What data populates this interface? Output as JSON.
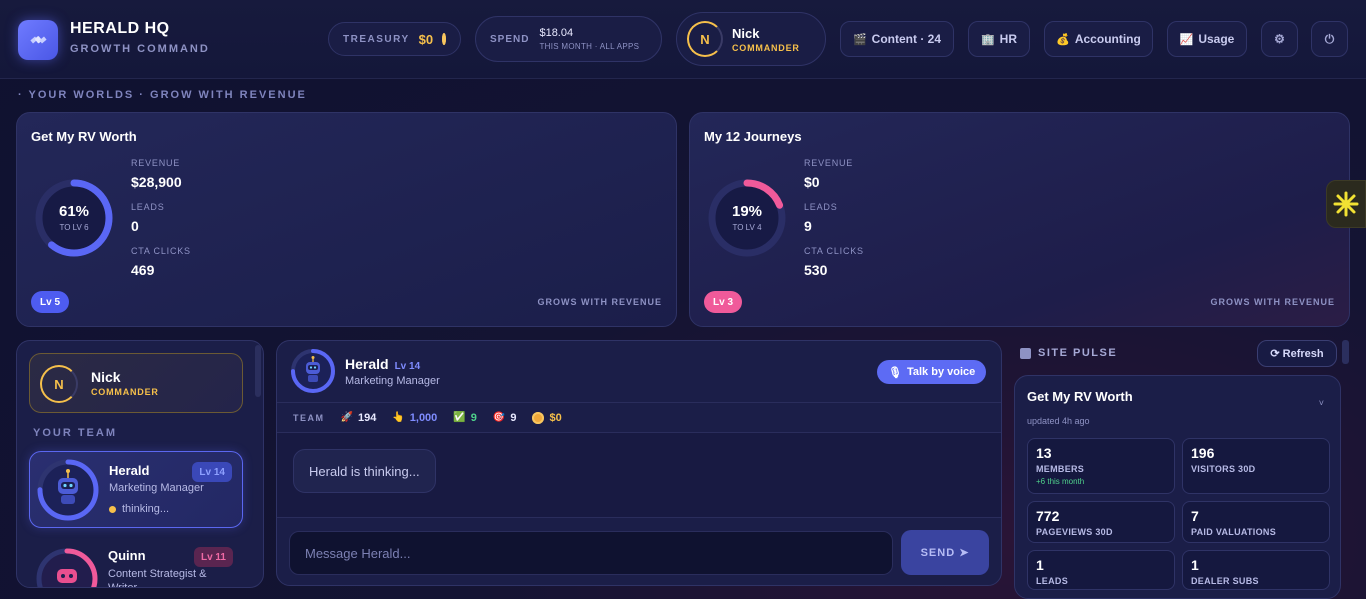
{
  "header": {
    "title": "HERALD HQ",
    "subtitle": "GROWTH COMMAND",
    "treasury_label": "TREASURY",
    "treasury_value": "$0",
    "spend_label": "SPEND",
    "spend_value": "$18.04",
    "spend_period": "THIS MONTH · ALL APPS",
    "user_initial": "N",
    "user_name": "Nick",
    "user_rank": "COMMANDER",
    "nav": {
      "content": "Content · 24",
      "hr": "HR",
      "accounting": "Accounting",
      "usage": "Usage"
    }
  },
  "worlds": {
    "section_label": "· YOUR WORLDS · GROW WITH REVENUE",
    "cards": [
      {
        "title": "Get My RV Worth",
        "progress_pct": "61%",
        "progress_value": 0.61,
        "progress_sub": "TO LV 6",
        "revenue_label": "REVENUE",
        "revenue": "$28,900",
        "leads_label": "LEADS",
        "leads": "0",
        "cta_label": "CTA CLICKS",
        "cta": "469",
        "level": "Lv 5",
        "footer": "GROWS WITH REVENUE",
        "accent": "#5a67f5"
      },
      {
        "title": "My 12 Journeys",
        "progress_pct": "19%",
        "progress_value": 0.19,
        "progress_sub": "TO LV 4",
        "revenue_label": "REVENUE",
        "revenue": "$0",
        "leads_label": "LEADS",
        "leads": "9",
        "cta_label": "CTA CLICKS",
        "cta": "530",
        "level": "Lv 3",
        "footer": "GROWS WITH REVENUE",
        "accent": "#f05a9a"
      }
    ]
  },
  "sidebar": {
    "commander_initial": "N",
    "commander_name": "Nick",
    "commander_rank": "COMMANDER",
    "team_label": "YOUR TEAM",
    "members": [
      {
        "name": "Herald",
        "role": "Marketing Manager",
        "level": "Lv 14",
        "status": "thinking...",
        "progress_value": 0.75
      },
      {
        "name": "Quinn",
        "role": "Content Strategist & Writer",
        "level": "Lv 11",
        "progress_value": 0.3
      }
    ]
  },
  "chat": {
    "agent_name": "Herald",
    "agent_level": "Lv 14",
    "agent_role": "Marketing Manager",
    "voice_label": "Talk by voice",
    "team_label": "TEAM",
    "team_stats": [
      {
        "icon": "rocket-icon",
        "glyph": "🚀",
        "value": "194",
        "color": "#e8e9ff"
      },
      {
        "icon": "pointer-icon",
        "glyph": "👆",
        "value": "1,000",
        "color": "#7f8cff"
      },
      {
        "icon": "check-icon",
        "glyph": "✅",
        "value": "9",
        "color": "#4fd18b"
      },
      {
        "icon": "target-icon",
        "glyph": "🎯",
        "value": "9",
        "color": "#e8e9ff"
      },
      {
        "icon": "coin-icon",
        "glyph": "",
        "value": "$0",
        "color": "#f6c04b"
      }
    ],
    "thinking_message": "Herald is thinking...",
    "input_placeholder": "Message Herald...",
    "send_label": "SEND ➤"
  },
  "pulse": {
    "label": "SITE PULSE",
    "refresh_label": "⟳ Refresh",
    "site_title": "Get My RV Worth",
    "updated": "updated 4h ago",
    "metrics": [
      {
        "value": "13",
        "label": "MEMBERS",
        "delta": "+6 this month"
      },
      {
        "value": "196",
        "label": "VISITORS 30D"
      },
      {
        "value": "772",
        "label": "PAGEVIEWS 30D"
      },
      {
        "value": "7",
        "label": "PAID VALUATIONS"
      },
      {
        "value": "1",
        "label": "LEADS"
      },
      {
        "value": "1",
        "label": "DEALER SUBS"
      }
    ]
  },
  "colors": {
    "accent_blue": "#5a67f5",
    "accent_pink": "#f05a9a",
    "gold": "#f6c04b",
    "background": "#141433"
  }
}
